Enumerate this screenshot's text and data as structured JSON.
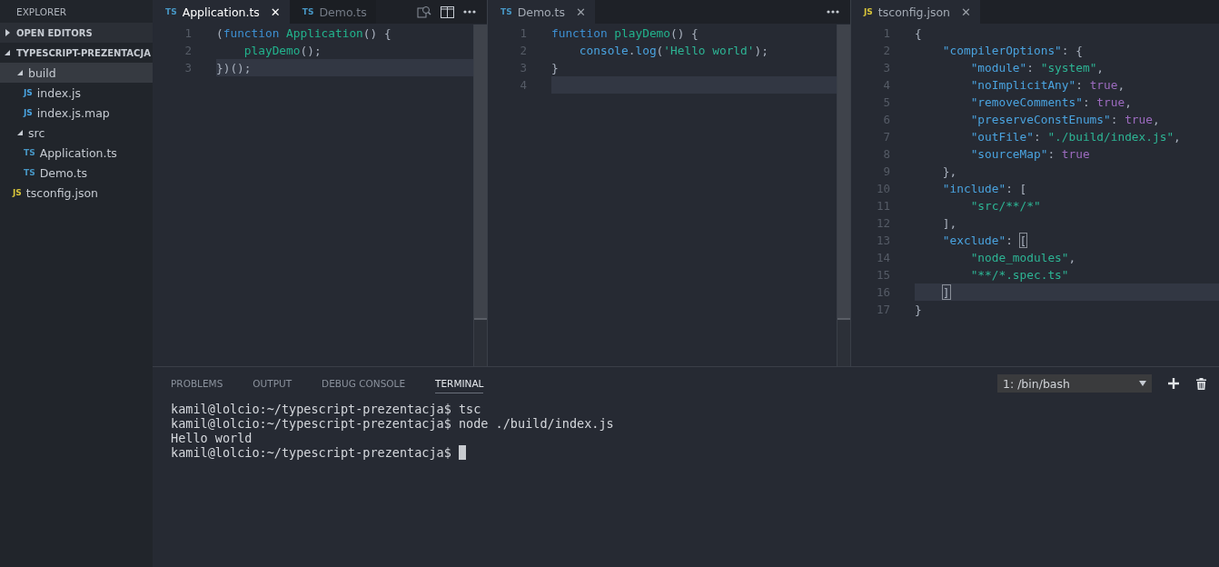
{
  "sidebar": {
    "title": "EXPLORER",
    "sections": [
      {
        "label": "OPEN EDITORS",
        "expanded": false
      },
      {
        "label": "TYPESCRIPT-PREZENTACJA",
        "expanded": true,
        "items": [
          {
            "kind": "folder",
            "label": "build",
            "expanded": true,
            "selected": true,
            "children": [
              {
                "kind": "js",
                "badge": "JS",
                "label": "index.js",
                "selected": false
              },
              {
                "kind": "js",
                "badge": "JS",
                "label": "index.js.map",
                "selected": false
              }
            ]
          },
          {
            "kind": "folder",
            "label": "src",
            "expanded": true,
            "selected": false,
            "children": [
              {
                "kind": "ts",
                "badge": "TS",
                "label": "Application.ts",
                "selected": false
              },
              {
                "kind": "ts",
                "badge": "TS",
                "label": "Demo.ts",
                "selected": false
              }
            ]
          },
          {
            "kind": "json",
            "badge": "JS",
            "label": "tsconfig.json",
            "selected": false
          }
        ]
      }
    ]
  },
  "editor_groups": [
    {
      "focused": true,
      "actions": [
        {
          "kind": "search"
        },
        {
          "kind": "split"
        },
        {
          "kind": "more"
        }
      ],
      "tabs": [
        {
          "badge": "TS",
          "label": "Application.ts",
          "selected": true,
          "close": "✕"
        },
        {
          "badge": "TS",
          "label": "Demo.ts",
          "selected": false
        }
      ],
      "scrollbar": true,
      "lines": [
        {
          "number": "1",
          "current": false,
          "tokens": [
            {
              "kind": "plain",
              "text": "("
            },
            {
              "kind": "keyword",
              "text": "function"
            },
            {
              "kind": "function",
              "text": " Application"
            },
            {
              "kind": "plain",
              "text": "() {"
            }
          ]
        },
        {
          "number": "2",
          "current": false,
          "tokens": [
            {
              "kind": "function",
              "text": "    playDemo"
            },
            {
              "kind": "plain",
              "text": "();"
            }
          ]
        },
        {
          "number": "3",
          "current": true,
          "tokens": [
            {
              "kind": "plain",
              "text": "})();"
            }
          ]
        }
      ]
    },
    {
      "focused": false,
      "actions": [
        {
          "kind": "more"
        }
      ],
      "tabs": [
        {
          "badge": "TS",
          "label": "Demo.ts",
          "selected": true,
          "close": "✕"
        }
      ],
      "scrollbar": true,
      "lines": [
        {
          "number": "1",
          "current": false,
          "tokens": [
            {
              "kind": "keyword",
              "text": "function"
            },
            {
              "kind": "function",
              "text": " playDemo"
            },
            {
              "kind": "plain",
              "text": "() {"
            }
          ]
        },
        {
          "number": "2",
          "current": false,
          "tokens": [
            {
              "kind": "property",
              "text": "    console"
            },
            {
              "kind": "plain",
              "text": "."
            },
            {
              "kind": "property",
              "text": "log"
            },
            {
              "kind": "plain",
              "text": "("
            },
            {
              "kind": "string",
              "text": "'Hello world'"
            },
            {
              "kind": "plain",
              "text": ");"
            }
          ]
        },
        {
          "number": "3",
          "current": false,
          "tokens": [
            {
              "kind": "plain",
              "text": "}"
            }
          ]
        },
        {
          "number": "4",
          "current": true
        }
      ]
    },
    {
      "focused": false,
      "tabs": [
        {
          "badge": "JS",
          "label": "tsconfig.json",
          "selected": true,
          "close": "✕"
        }
      ],
      "scrollbar": false,
      "lines": [
        {
          "number": "1",
          "current": false,
          "tokens": [
            {
              "kind": "plain",
              "text": "{"
            }
          ]
        },
        {
          "number": "2",
          "current": false,
          "tokens": [
            {
              "kind": "property",
              "text": "    \"compilerOptions\""
            },
            {
              "kind": "plain",
              "text": ": {"
            }
          ]
        },
        {
          "number": "3",
          "current": false,
          "tokens": [
            {
              "kind": "property",
              "text": "        \"module\""
            },
            {
              "kind": "plain",
              "text": ": "
            },
            {
              "kind": "string",
              "text": "\"system\""
            },
            {
              "kind": "plain",
              "text": ","
            }
          ]
        },
        {
          "number": "4",
          "current": false,
          "tokens": [
            {
              "kind": "property",
              "text": "        \"noImplicitAny\""
            },
            {
              "kind": "plain",
              "text": ": "
            },
            {
              "kind": "constant",
              "text": "true"
            },
            {
              "kind": "plain",
              "text": ","
            }
          ]
        },
        {
          "number": "5",
          "current": false,
          "tokens": [
            {
              "kind": "property",
              "text": "        \"removeComments\""
            },
            {
              "kind": "plain",
              "text": ": "
            },
            {
              "kind": "constant",
              "text": "true"
            },
            {
              "kind": "plain",
              "text": ","
            }
          ]
        },
        {
          "number": "6",
          "current": false,
          "tokens": [
            {
              "kind": "property",
              "text": "        \"preserveConstEnums\""
            },
            {
              "kind": "plain",
              "text": ": "
            },
            {
              "kind": "constant",
              "text": "true"
            },
            {
              "kind": "plain",
              "text": ","
            }
          ]
        },
        {
          "number": "7",
          "current": false,
          "tokens": [
            {
              "kind": "property",
              "text": "        \"outFile\""
            },
            {
              "kind": "plain",
              "text": ": "
            },
            {
              "kind": "string",
              "text": "\"./build/index.js\""
            },
            {
              "kind": "plain",
              "text": ","
            }
          ]
        },
        {
          "number": "8",
          "current": false,
          "tokens": [
            {
              "kind": "property",
              "text": "        \"sourceMap\""
            },
            {
              "kind": "plain",
              "text": ": "
            },
            {
              "kind": "constant",
              "text": "true"
            }
          ]
        },
        {
          "number": "9",
          "current": false,
          "tokens": [
            {
              "kind": "plain",
              "text": "    },"
            }
          ]
        },
        {
          "number": "10",
          "current": false,
          "tokens": [
            {
              "kind": "property",
              "text": "    \"include\""
            },
            {
              "kind": "plain",
              "text": ": ["
            }
          ]
        },
        {
          "number": "11",
          "current": false,
          "tokens": [
            {
              "kind": "string",
              "text": "        \"src/**/*\""
            }
          ]
        },
        {
          "number": "12",
          "current": false,
          "tokens": [
            {
              "kind": "plain",
              "text": "    ],"
            }
          ]
        },
        {
          "number": "13",
          "current": false,
          "tokens": [
            {
              "kind": "property",
              "text": "    \"exclude\""
            },
            {
              "kind": "plain",
              "text": ": "
            },
            {
              "kind": "bracket",
              "text": "["
            }
          ]
        },
        {
          "number": "14",
          "current": false,
          "tokens": [
            {
              "kind": "string",
              "text": "        \"node_modules\""
            },
            {
              "kind": "plain",
              "text": ","
            }
          ]
        },
        {
          "number": "15",
          "current": false,
          "tokens": [
            {
              "kind": "string",
              "text": "        \"**/*.spec.ts\""
            }
          ]
        },
        {
          "number": "16",
          "current": true,
          "tokens": [
            {
              "kind": "bracket",
              "text": "    ]"
            }
          ]
        },
        {
          "number": "17",
          "current": false,
          "tokens": [
            {
              "kind": "plain",
              "text": "}"
            }
          ]
        }
      ]
    }
  ],
  "panel": {
    "tabs": [
      {
        "label": "PROBLEMS",
        "selected": false
      },
      {
        "label": "OUTPUT",
        "selected": false
      },
      {
        "label": "DEBUG CONSOLE",
        "selected": false
      },
      {
        "label": "TERMINAL",
        "selected": true
      }
    ],
    "terminal_select": "1: /bin/bash",
    "terminal": [
      {
        "text": "kamil@lolcio:~/typescript-prezentacja$ tsc",
        "cursor": false
      },
      {
        "text": "kamil@lolcio:~/typescript-prezentacja$ node ./build/index.js",
        "cursor": false
      },
      {
        "text": "Hello world",
        "cursor": false
      },
      {
        "text": "kamil@lolcio:~/typescript-prezentacja$",
        "cursor": true
      }
    ]
  }
}
